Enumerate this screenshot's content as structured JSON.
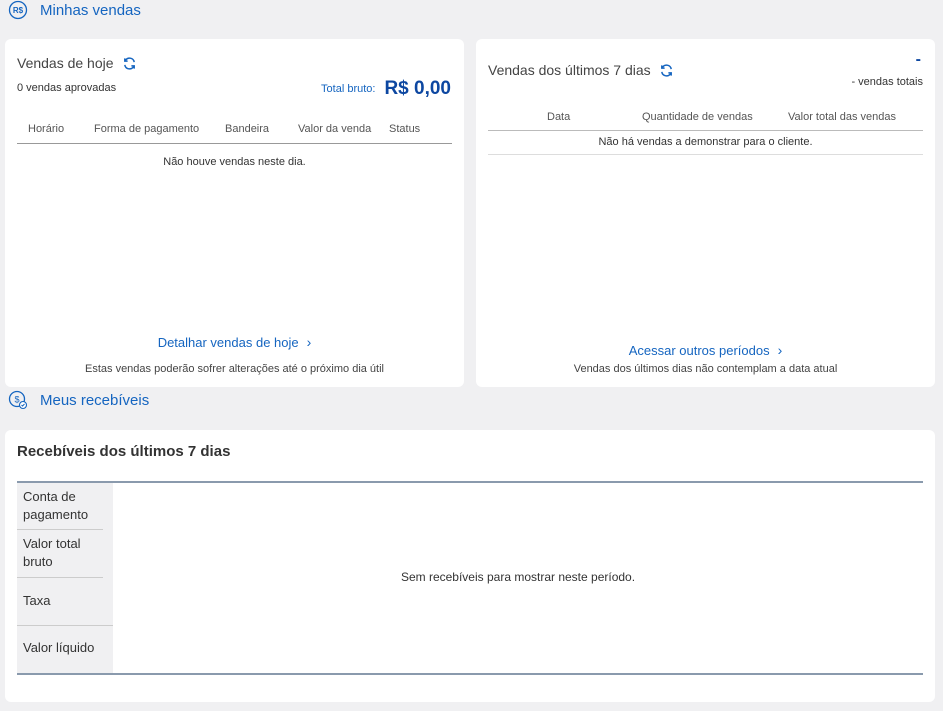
{
  "sales_section": {
    "title": "Minhas vendas",
    "icon": "brl-currency-icon"
  },
  "today": {
    "title": "Vendas de hoje",
    "approved": "0 vendas aprovadas",
    "total_label": "Total bruto:",
    "total_value": "R$ 0,00",
    "columns": [
      "Horário",
      "Forma de pagamento",
      "Bandeira",
      "Valor da venda",
      "Status"
    ],
    "empty": "Não houve vendas neste dia.",
    "link": "Detalhar vendas de hoje",
    "note": "Estas vendas poderão sofrer alterações até o próximo dia útil"
  },
  "week": {
    "title": "Vendas dos últimos 7 dias",
    "dash": "-",
    "total_sales": "- vendas totais",
    "columns": [
      "Data",
      "Quantidade de vendas",
      "Valor total das vendas"
    ],
    "empty": "Não há vendas a demonstrar para o cliente.",
    "link": "Acessar outros períodos",
    "note": "Vendas dos últimos dias não contemplam a data atual"
  },
  "receivables_section": {
    "title": "Meus recebíveis",
    "icon": "money-receive-icon"
  },
  "receivables": {
    "title": "Recebíveis dos últimos 7 dias",
    "rows": [
      "Conta de pagamento",
      "Valor total bruto",
      "Taxa",
      "Valor líquido"
    ],
    "empty": "Sem recebíveis para mostrar neste período."
  },
  "colors": {
    "accent": "#1565c0",
    "background": "#f0f0f2",
    "card": "#ffffff"
  }
}
